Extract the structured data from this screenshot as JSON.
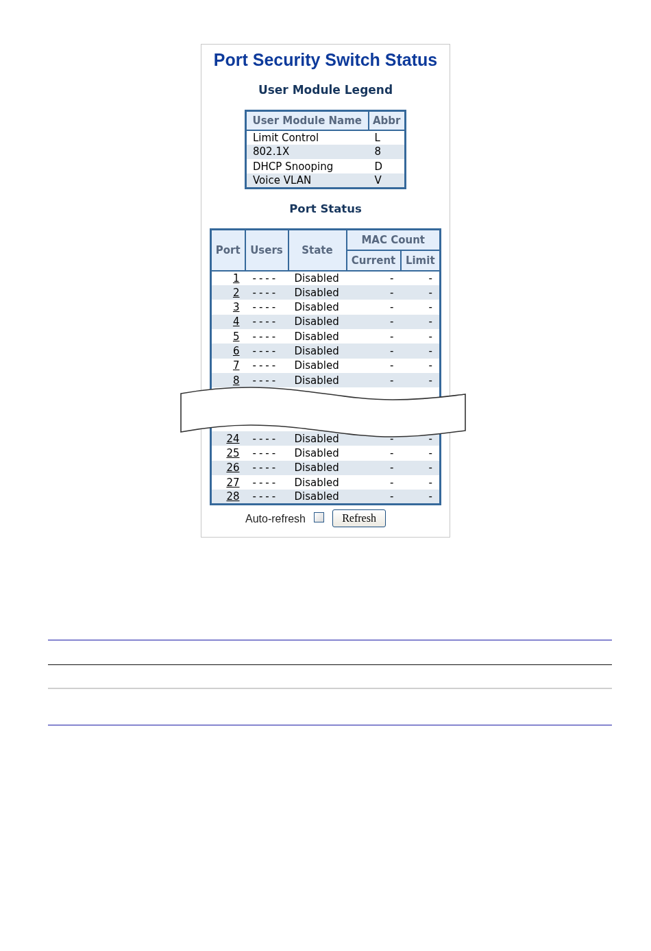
{
  "title": "Port Security Switch Status",
  "legend": {
    "heading": "User Module Legend",
    "columns": [
      "User Module Name",
      "Abbr"
    ],
    "rows": [
      {
        "name": "Limit Control",
        "abbr": "L"
      },
      {
        "name": "802.1X",
        "abbr": "8"
      },
      {
        "name": "DHCP Snooping",
        "abbr": "D"
      },
      {
        "name": "Voice VLAN",
        "abbr": "V"
      }
    ]
  },
  "port_status": {
    "heading": "Port Status",
    "columns": {
      "port": "Port",
      "users": "Users",
      "state": "State",
      "mac_count": "MAC Count",
      "current": "Current",
      "limit": "Limit"
    },
    "rows": [
      {
        "kind": "port",
        "port": "1",
        "users": "----",
        "state": "Disabled",
        "current": "-",
        "limit": "-"
      },
      {
        "kind": "port",
        "port": "2",
        "users": "----",
        "state": "Disabled",
        "current": "-",
        "limit": "-"
      },
      {
        "kind": "port",
        "port": "3",
        "users": "----",
        "state": "Disabled",
        "current": "-",
        "limit": "-"
      },
      {
        "kind": "port",
        "port": "4",
        "users": "----",
        "state": "Disabled",
        "current": "-",
        "limit": "-"
      },
      {
        "kind": "port",
        "port": "5",
        "users": "----",
        "state": "Disabled",
        "current": "-",
        "limit": "-"
      },
      {
        "kind": "port",
        "port": "6",
        "users": "----",
        "state": "Disabled",
        "current": "-",
        "limit": "-"
      },
      {
        "kind": "port",
        "port": "7",
        "users": "----",
        "state": "Disabled",
        "current": "-",
        "limit": "-"
      },
      {
        "kind": "port",
        "port": "8",
        "users": "----",
        "state": "Disabled",
        "current": "-",
        "limit": "-"
      },
      {
        "kind": "break"
      },
      {
        "kind": "port",
        "port": "24",
        "users": "----",
        "state": "Disabled",
        "current": "-",
        "limit": "-"
      },
      {
        "kind": "port",
        "port": "25",
        "users": "----",
        "state": "Disabled",
        "current": "-",
        "limit": "-"
      },
      {
        "kind": "port",
        "port": "26",
        "users": "----",
        "state": "Disabled",
        "current": "-",
        "limit": "-"
      },
      {
        "kind": "port",
        "port": "27",
        "users": "----",
        "state": "Disabled",
        "current": "-",
        "limit": "-"
      },
      {
        "kind": "port",
        "port": "28",
        "users": "----",
        "state": "Disabled",
        "current": "-",
        "limit": "-"
      }
    ]
  },
  "auto_refresh": {
    "label": "Auto-refresh",
    "checked": false
  },
  "refresh_button": {
    "label": "Refresh"
  }
}
